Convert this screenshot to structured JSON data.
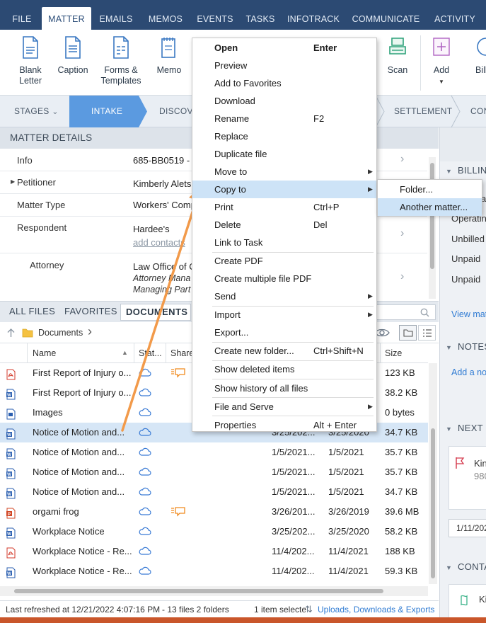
{
  "ribbon_tabs": [
    "FILE",
    "MATTER",
    "EMAILS",
    "MEMOS",
    "EVENTS",
    "TASKS",
    "INFOTRACK",
    "COMMUNICATE",
    "ACTIVITY"
  ],
  "ribbon_buttons": {
    "blank_letter": "Blank\nLetter",
    "caption": "Caption",
    "forms_templates": "Forms &\nTemplates",
    "memo": "Memo",
    "scan": "Scan",
    "add": "Add",
    "billing": "Bill"
  },
  "stages": {
    "stages_label": "STAGES",
    "intake": "INTAKE",
    "discovery": "DISCOVE",
    "settlement": "SETTLEMENT",
    "next": "CON"
  },
  "matter_details": {
    "header": "MATTER DETAILS",
    "rows": [
      {
        "label": "Info",
        "value": "685-BB0519 - "
      },
      {
        "label": "Petitioner",
        "value": "Kimberly Alets"
      },
      {
        "label": "Matter Type",
        "value": "Workers' Comp"
      },
      {
        "label": "Respondent",
        "value": "Hardee's",
        "link": "add contacts"
      },
      {
        "label": "Attorney",
        "value": "Law Office of C",
        "sub1": "Attorney Mana",
        "sub2": "Managing Part"
      }
    ]
  },
  "file_tabs": {
    "all": "ALL FILES",
    "favorites": "FAVORITES",
    "documents": "DOCUMENTS"
  },
  "breadcrumb": {
    "folder": "Documents"
  },
  "columns": {
    "name": "Name",
    "status": "Stat...",
    "shared": "Share",
    "size": "Size"
  },
  "files": [
    {
      "name": "First Report of Injury o...",
      "created": "",
      "modified": "",
      "size": "123 KB",
      "type": "pdf",
      "shared": true,
      "selected": false
    },
    {
      "name": "First Report of Injury o...",
      "created": "",
      "modified": "",
      "size": "38.2 KB",
      "type": "word",
      "shared": false,
      "selected": false
    },
    {
      "name": "Images",
      "created": "",
      "modified": "",
      "size": "0 bytes",
      "type": "file",
      "shared": false,
      "selected": false
    },
    {
      "name": "Notice of Motion and...",
      "created": "3/25/202...",
      "modified": "3/25/2020",
      "size": "34.7 KB",
      "type": "word",
      "shared": false,
      "selected": true
    },
    {
      "name": "Notice of Motion and...",
      "created": "1/5/2021...",
      "modified": "1/5/2021",
      "size": "35.7 KB",
      "type": "word",
      "shared": false,
      "selected": false
    },
    {
      "name": "Notice of Motion and...",
      "created": "1/5/2021...",
      "modified": "1/5/2021",
      "size": "35.7 KB",
      "type": "word",
      "shared": false,
      "selected": false
    },
    {
      "name": "Notice of Motion and...",
      "created": "1/5/2021...",
      "modified": "1/5/2021",
      "size": "34.7 KB",
      "type": "word",
      "shared": false,
      "selected": false
    },
    {
      "name": "orgami frog",
      "created": "3/26/201...",
      "modified": "3/26/2019",
      "size": "39.6 MB",
      "type": "ppt",
      "shared": true,
      "selected": false
    },
    {
      "name": "Workplace Notice",
      "created": "3/25/202...",
      "modified": "3/25/2020",
      "size": "58.2 KB",
      "type": "word",
      "shared": false,
      "selected": false
    },
    {
      "name": "Workplace Notice - Re...",
      "created": "11/4/202...",
      "modified": "11/4/2021",
      "size": "188 KB",
      "type": "pdf",
      "shared": false,
      "selected": false
    },
    {
      "name": "Workplace Notice - Re...",
      "created": "11/4/202...",
      "modified": "11/4/2021",
      "size": "59.3 KB",
      "type": "word",
      "shared": false,
      "selected": false
    }
  ],
  "status_bar": {
    "refreshed": "Last refreshed at 12/21/2022 4:07:16 PM",
    "counts": "-  13 files  2 folders",
    "selected": "1 item selecte",
    "link": "Uploads, Downloads & Exports"
  },
  "right_panel": {
    "billing": "BILLING",
    "operating1": "a",
    "operating2": "Operating",
    "unbilled": "Unbilled",
    "unpaid1": "Unpaid",
    "unpaid2": "Unpaid",
    "view_more": "View mat",
    "notes": "NOTES",
    "add_note": "Add a not",
    "next_steps": "NEXT S",
    "flag_name": "Kin",
    "flag_num": "980",
    "date": "1/11/202",
    "contacts": "CONTA",
    "contact_initial": "Ki"
  },
  "context_menu": [
    {
      "label": "Open",
      "shortcut": "Enter",
      "bold": true
    },
    {
      "label": "Preview"
    },
    {
      "label": "Add to Favorites"
    },
    {
      "label": "Download"
    },
    {
      "label": "Rename",
      "shortcut": "F2"
    },
    {
      "label": "Replace"
    },
    {
      "label": "Duplicate file"
    },
    {
      "label": "Move to",
      "submenu": true
    },
    {
      "label": "Copy to",
      "submenu": true,
      "highlighted": true
    },
    {
      "label": "Print",
      "shortcut": "Ctrl+P"
    },
    {
      "label": "Delete",
      "shortcut": "Del"
    },
    {
      "label": "Link to Task"
    },
    {
      "label": "Create PDF",
      "sep_before": true
    },
    {
      "label": "Create multiple file PDF"
    },
    {
      "label": "Send",
      "submenu": true
    },
    {
      "label": "Import",
      "submenu": true,
      "sep_before": true
    },
    {
      "label": "Export..."
    },
    {
      "label": "Create new folder...",
      "shortcut": "Ctrl+Shift+N",
      "sep_before": true
    },
    {
      "label": "Show deleted items",
      "sep_before": true
    },
    {
      "label": "Show history of all files",
      "sep_before": true
    },
    {
      "label": "File and Serve",
      "submenu": true,
      "sep_before": true
    },
    {
      "label": "Properties",
      "shortcut": "Alt + Enter",
      "sep_before": true
    }
  ],
  "submenu": [
    {
      "label": "Folder..."
    },
    {
      "label": "Another matter...",
      "highlighted": true
    }
  ],
  "colors": {
    "navy": "#2c4a73",
    "intake_blue": "#5b9ae0",
    "highlight": "#cde3f7",
    "arrow": "#f29a4a",
    "link": "#2f7bd3"
  }
}
